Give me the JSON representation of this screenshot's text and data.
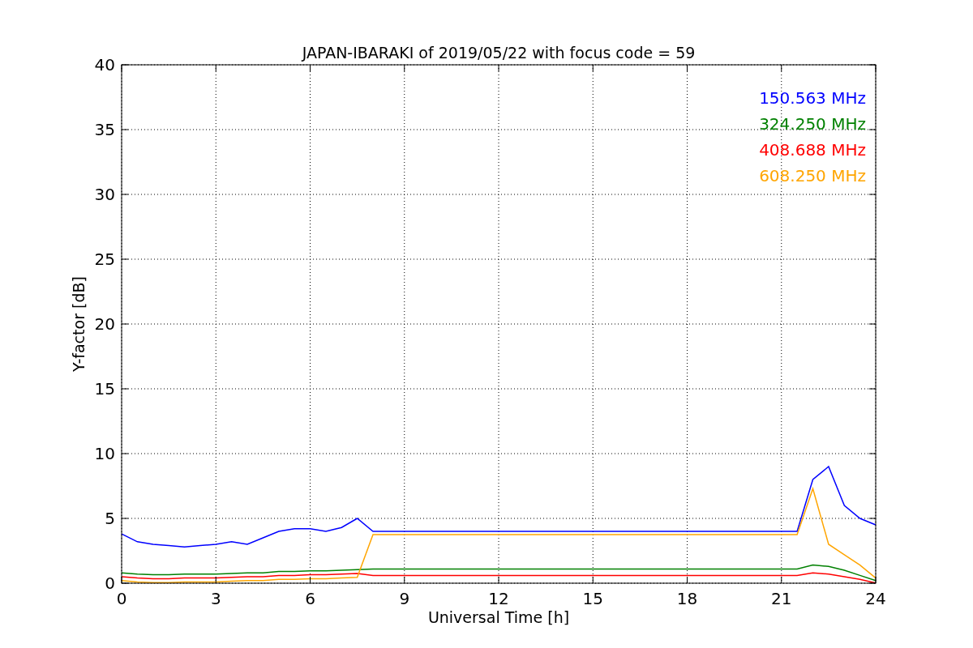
{
  "chart_data": {
    "type": "line",
    "title": "JAPAN-IBARAKI of 2019/05/22 with focus code = 59",
    "xlabel": "Universal Time [h]",
    "ylabel": "Y-factor [dB]",
    "grid": true,
    "x": [
      0,
      0.5,
      1,
      1.5,
      2,
      2.5,
      3,
      3.5,
      4,
      4.5,
      5,
      5.5,
      6,
      6.5,
      7,
      7.5,
      8,
      8.5,
      9,
      9.5,
      10,
      10.5,
      11,
      11.5,
      12,
      12.5,
      13,
      13.5,
      14,
      14.5,
      15,
      15.5,
      16,
      16.5,
      17,
      17.5,
      18,
      18.5,
      19,
      19.5,
      20,
      20.5,
      21,
      21.5,
      22,
      22.5,
      23,
      23.5,
      24
    ],
    "series": [
      {
        "name": "150.563 MHz",
        "color": "#0000ff",
        "values": [
          3.8,
          3.2,
          3.0,
          2.9,
          2.8,
          2.9,
          3.0,
          3.2,
          3.0,
          3.5,
          4.0,
          4.2,
          4.2,
          4.0,
          4.3,
          5.0,
          4.0,
          4.0,
          4.0,
          4.0,
          4.0,
          4.0,
          4.0,
          4.0,
          4.0,
          4.0,
          4.0,
          4.0,
          4.0,
          4.0,
          4.0,
          4.0,
          4.0,
          4.0,
          4.0,
          4.0,
          4.0,
          4.0,
          4.0,
          4.0,
          4.0,
          4.0,
          4.0,
          4.0,
          8.0,
          9.0,
          6.0,
          5.0,
          4.5
        ]
      },
      {
        "name": "324.250 MHz",
        "color": "#008000",
        "values": [
          0.8,
          0.7,
          0.65,
          0.65,
          0.7,
          0.7,
          0.7,
          0.75,
          0.8,
          0.8,
          0.9,
          0.9,
          0.95,
          0.95,
          1.0,
          1.05,
          1.1,
          1.1,
          1.1,
          1.1,
          1.1,
          1.1,
          1.1,
          1.1,
          1.1,
          1.1,
          1.1,
          1.1,
          1.1,
          1.1,
          1.1,
          1.1,
          1.1,
          1.1,
          1.1,
          1.1,
          1.1,
          1.1,
          1.1,
          1.1,
          1.1,
          1.1,
          1.1,
          1.1,
          1.4,
          1.3,
          1.0,
          0.6,
          0.2
        ]
      },
      {
        "name": "408.688 MHz",
        "color": "#ff0000",
        "values": [
          0.5,
          0.4,
          0.35,
          0.35,
          0.4,
          0.4,
          0.4,
          0.45,
          0.5,
          0.5,
          0.6,
          0.6,
          0.65,
          0.65,
          0.7,
          0.75,
          0.6,
          0.6,
          0.6,
          0.6,
          0.6,
          0.6,
          0.6,
          0.6,
          0.6,
          0.6,
          0.6,
          0.6,
          0.6,
          0.6,
          0.6,
          0.6,
          0.6,
          0.6,
          0.6,
          0.6,
          0.6,
          0.6,
          0.6,
          0.6,
          0.6,
          0.6,
          0.6,
          0.6,
          0.8,
          0.7,
          0.5,
          0.3,
          0.02
        ]
      },
      {
        "name": "608.250 MHz",
        "color": "#ffa500",
        "values": [
          0.2,
          0.1,
          0.05,
          0.05,
          0.1,
          0.1,
          0.1,
          0.15,
          0.2,
          0.2,
          0.3,
          0.3,
          0.35,
          0.35,
          0.4,
          0.45,
          3.75,
          3.75,
          3.75,
          3.75,
          3.75,
          3.75,
          3.75,
          3.75,
          3.75,
          3.75,
          3.75,
          3.75,
          3.75,
          3.75,
          3.75,
          3.75,
          3.75,
          3.75,
          3.75,
          3.75,
          3.75,
          3.75,
          3.75,
          3.75,
          3.75,
          3.75,
          3.75,
          3.75,
          7.3,
          3.0,
          2.2,
          1.4,
          0.4
        ]
      }
    ],
    "xlim": [
      0,
      24
    ],
    "ylim": [
      0,
      40
    ],
    "xticks": [
      0,
      3,
      6,
      9,
      12,
      15,
      18,
      21,
      24
    ],
    "yticks": [
      0,
      5,
      10,
      15,
      20,
      25,
      30,
      35,
      40
    ]
  }
}
